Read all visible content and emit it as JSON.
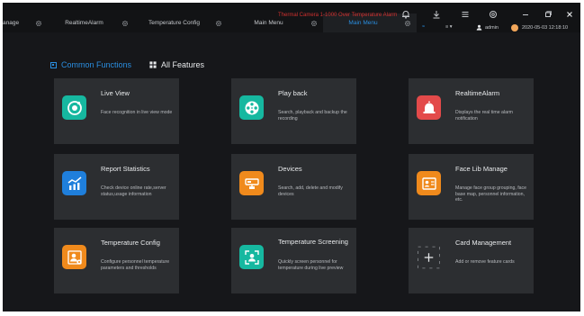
{
  "colors": {
    "accent": "#2a8ee0",
    "alarm_text": "#d0302f",
    "teal": "#16b8a0",
    "red": "#e34a4a",
    "blue": "#1f7fdc",
    "orange": "#f08a1c"
  },
  "tabs": [
    {
      "label": "anage"
    },
    {
      "label": "RealtimeAlarm"
    },
    {
      "label": "Temperature Config"
    },
    {
      "label": "Main Menu"
    },
    {
      "label": "Main Menu",
      "active": true
    }
  ],
  "topbar": {
    "alarm_message": "Thermal Camera 1-1000 Over Temperature Alarm",
    "user": "admin",
    "datetime": "2020-05-03 12:18:10",
    "status_a": "≈",
    "status_b": "≡ ▾"
  },
  "feature_tabs": {
    "common": "Common Functions",
    "all": "All Features"
  },
  "cards": [
    {
      "title": "Live View",
      "desc": "Face recognition in live view mode",
      "icon": "live-view-icon",
      "color": "#16b8a0"
    },
    {
      "title": "Play back",
      "desc": "Search, playback and backup the recording",
      "icon": "film-reel-icon",
      "color": "#16b8a0"
    },
    {
      "title": "RealtimeAlarm",
      "desc": "Displays the real time alarm notification",
      "icon": "alarm-bell-icon",
      "color": "#e34a4a"
    },
    {
      "title": "Report Statistics",
      "desc": "Check device online rate,server status,usage information",
      "icon": "chart-icon",
      "color": "#1f7fdc"
    },
    {
      "title": "Devices",
      "desc": "Search, add, delete and modify devices",
      "icon": "device-icon",
      "color": "#f08a1c"
    },
    {
      "title": "Face Lib Manage",
      "desc": "Manage face group grouping, face base map, personnel information, etc.",
      "icon": "id-card-icon",
      "color": "#f08a1c"
    },
    {
      "title": "Temperature Config",
      "desc": "Configure personnel temperature parameters and thresholds",
      "icon": "person-gear-icon",
      "color": "#f08a1c"
    },
    {
      "title": "Temperature Screening",
      "desc": "Quickly screen personnel for temperature during live preview",
      "icon": "person-frame-icon",
      "color": "#16b8a0"
    },
    {
      "title": "Card Management",
      "desc": "Add or remove feature cards",
      "icon": "add-card-icon",
      "color": ""
    }
  ]
}
